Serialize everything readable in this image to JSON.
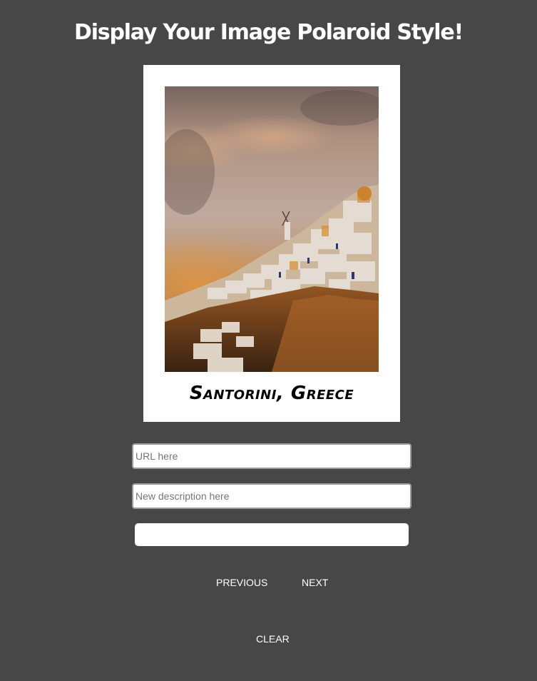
{
  "page": {
    "title": "Display Your Image Polaroid Style!"
  },
  "polaroid": {
    "caption": "Santorini, Greece",
    "photo_alt": "Santorini, Greece"
  },
  "form": {
    "url_placeholder": "URL here",
    "url_value": "",
    "description_placeholder": "New description here",
    "description_value": "",
    "submit_label": ""
  },
  "nav": {
    "previous_label": "PREVIOUS",
    "next_label": "NEXT",
    "clear_label": "CLEAR"
  },
  "colors": {
    "background": "#474747",
    "polaroid_frame": "#ffffff",
    "text": "#ffffff"
  }
}
